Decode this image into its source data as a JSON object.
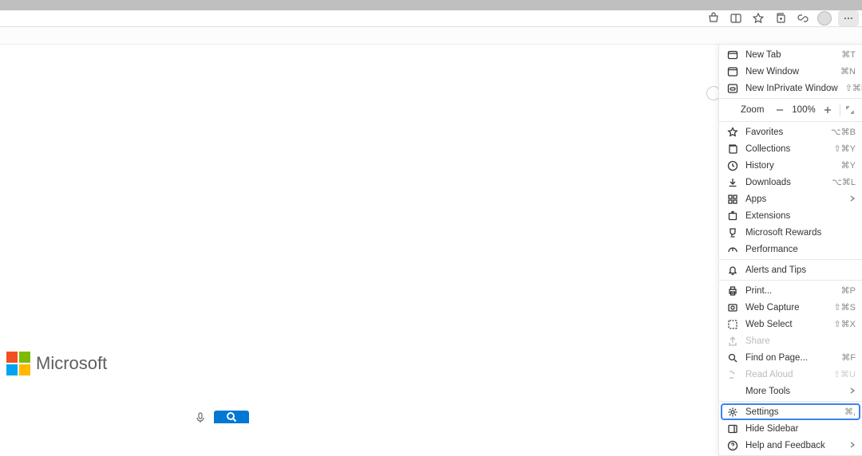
{
  "toolbar": {
    "icons": [
      "shopping-icon",
      "split-icon",
      "star-icon",
      "collections-icon",
      "share-icon"
    ],
    "more": "..."
  },
  "menu": {
    "new_tab": {
      "label": "New Tab",
      "shortcut": "⌘T"
    },
    "new_window": {
      "label": "New Window",
      "shortcut": "⌘N"
    },
    "new_inprivate": {
      "label": "New InPrivate Window",
      "shortcut": "⇧⌘N"
    },
    "zoom": {
      "label": "Zoom",
      "value": "100%"
    },
    "favorites": {
      "label": "Favorites",
      "shortcut": "⌥⌘B"
    },
    "collections": {
      "label": "Collections",
      "shortcut": "⇧⌘Y"
    },
    "history": {
      "label": "History",
      "shortcut": "⌘Y"
    },
    "downloads": {
      "label": "Downloads",
      "shortcut": "⌥⌘L"
    },
    "apps": {
      "label": "Apps"
    },
    "extensions": {
      "label": "Extensions"
    },
    "rewards": {
      "label": "Microsoft Rewards"
    },
    "performance": {
      "label": "Performance"
    },
    "alerts": {
      "label": "Alerts and Tips"
    },
    "print": {
      "label": "Print...",
      "shortcut": "⌘P"
    },
    "web_capture": {
      "label": "Web Capture",
      "shortcut": "⇧⌘S"
    },
    "web_select": {
      "label": "Web Select",
      "shortcut": "⇧⌘X"
    },
    "share": {
      "label": "Share"
    },
    "find": {
      "label": "Find on Page...",
      "shortcut": "⌘F"
    },
    "read_aloud": {
      "label": "Read Aloud",
      "shortcut": "⇧⌘U"
    },
    "more_tools": {
      "label": "More Tools"
    },
    "settings": {
      "label": "Settings",
      "shortcut": "⌘,"
    },
    "hide_sidebar": {
      "label": "Hide Sidebar"
    },
    "help": {
      "label": "Help and Feedback"
    }
  },
  "logo": {
    "text": "Microsoft"
  }
}
